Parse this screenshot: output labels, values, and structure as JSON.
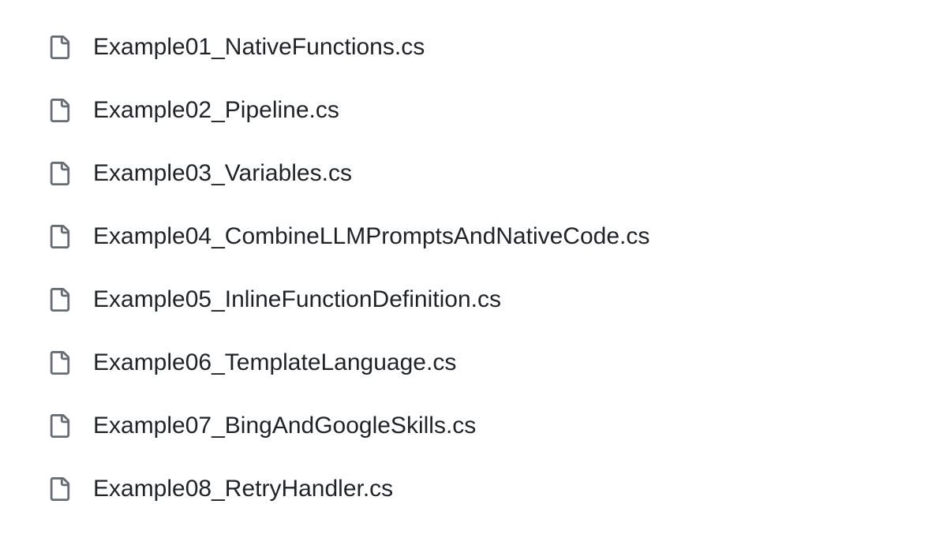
{
  "files": [
    {
      "name": "Example01_NativeFunctions.cs"
    },
    {
      "name": "Example02_Pipeline.cs"
    },
    {
      "name": "Example03_Variables.cs"
    },
    {
      "name": "Example04_CombineLLMPromptsAndNativeCode.cs"
    },
    {
      "name": "Example05_InlineFunctionDefinition.cs"
    },
    {
      "name": "Example06_TemplateLanguage.cs"
    },
    {
      "name": "Example07_BingAndGoogleSkills.cs"
    },
    {
      "name": "Example08_RetryHandler.cs"
    }
  ]
}
